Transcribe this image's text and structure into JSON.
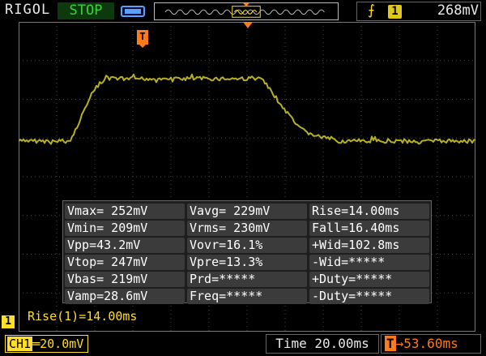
{
  "header": {
    "brand": "RIGOL",
    "run_status": "STOP",
    "trigger_source": "1",
    "trigger_level": "268mV"
  },
  "trigger_position_marker": "T",
  "measurements": {
    "rows": [
      [
        "Vmax= 252mV",
        "Vavg= 229mV",
        "Rise=14.00ms"
      ],
      [
        "Vmin= 209mV",
        "Vrms= 230mV",
        "Fall=16.40ms"
      ],
      [
        "Vpp=43.2mV",
        "Vovr=16.1%",
        "+Wid=102.8ms"
      ],
      [
        "Vtop= 247mV",
        "Vpre=13.3%",
        "-Wid=*****"
      ],
      [
        "Vbas= 219mV",
        "Prd=*****",
        "+Duty=*****"
      ],
      [
        "Vamp=28.6mV",
        "Freq=*****",
        "-Duty=*****"
      ]
    ],
    "readout": "Rise(1)=14.00ms"
  },
  "channel": {
    "tag": "1",
    "label": "CH1",
    "scale": "20.0mV"
  },
  "timebase": {
    "time": "Time 20.00ms",
    "delay": "53.60ms"
  },
  "colors": {
    "trace": "#b8b024",
    "channel": "#ffde2a",
    "trigger": "#ff7a1a",
    "status_bg": "#0c3a0c",
    "status_fg": "#3ad13a"
  }
}
